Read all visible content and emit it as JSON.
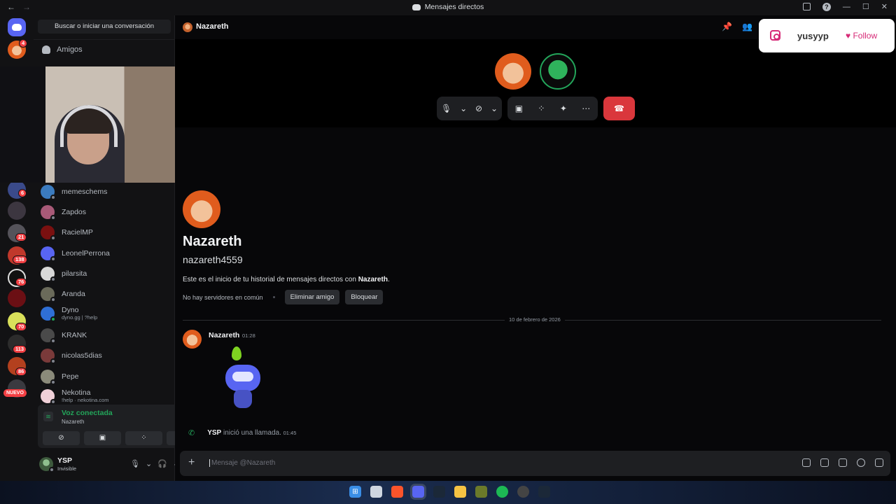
{
  "window": {
    "title": "Mensajes directos",
    "back_arrow": "←",
    "forward_arrow": "→",
    "help": "?",
    "minimize": "—",
    "maximize": "☐",
    "close": "✕"
  },
  "rail": {
    "badges": [
      "4",
      "6",
      "21",
      "138",
      "76",
      "70",
      "113",
      "86"
    ],
    "nuevo_label": "NUEVO"
  },
  "sidebar": {
    "search_button": "Buscar o iniciar una conversación",
    "friends_label": "Amigos",
    "dms": [
      {
        "name": "memeschems",
        "status": "offline"
      },
      {
        "name": "Zapdos",
        "status": "offline"
      },
      {
        "name": "RacielMP",
        "status": "offline"
      },
      {
        "name": "LeonelPerrona",
        "status": "offline"
      },
      {
        "name": "pilarsita",
        "status": "offline"
      },
      {
        "name": "Aranda",
        "status": "offline"
      },
      {
        "name": "Dyno",
        "sub": "dyno.gg | ?help",
        "status": "online"
      },
      {
        "name": "KRANK",
        "status": "offline"
      },
      {
        "name": "nicolas5dias",
        "status": "offline"
      },
      {
        "name": "Pepe",
        "status": "offline"
      },
      {
        "name": "Nekotina",
        "sub": "!help · nekotina.com",
        "status": "offline"
      }
    ]
  },
  "voice": {
    "title": "Voz conectada",
    "channel": "Nazareth"
  },
  "user": {
    "name": "YSP",
    "status": "Invisible"
  },
  "header": {
    "name": "Nazareth"
  },
  "profile": {
    "display_name": "Nazareth",
    "username": "nazareth4559",
    "intro_prefix": "Este es el inicio de tu historial de mensajes directos con ",
    "intro_name": "Nazareth",
    "intro_suffix": ".",
    "no_servers": "No hay servidores en común",
    "remove_friend": "Eliminar amigo",
    "block": "Bloquear"
  },
  "chat": {
    "date_divider": "10 de febrero de 2026",
    "message_author": "Nazareth",
    "message_time": "01:28",
    "system_user": "YSP",
    "system_text": "inició una llamada.",
    "system_time": "01:45",
    "composer_placeholder": "Mensaje @Nazareth"
  },
  "instagram": {
    "handle": "yusyyp",
    "follow": "Follow"
  },
  "colors": {
    "accent": "#5865f2",
    "online": "#23a55a",
    "danger": "#da373c",
    "instagram": "#d62976"
  }
}
